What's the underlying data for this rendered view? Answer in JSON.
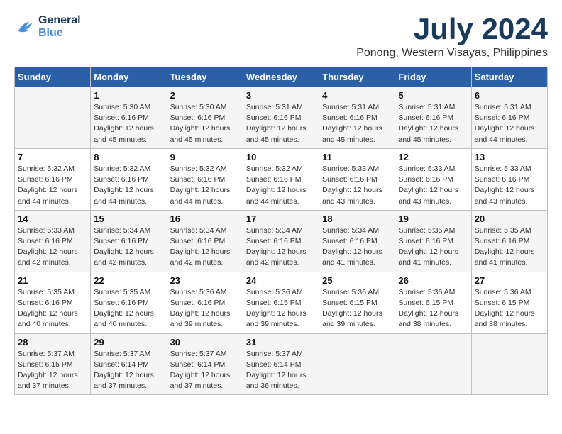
{
  "header": {
    "logo_line1": "General",
    "logo_line2": "Blue",
    "title": "July 2024",
    "subtitle": "Ponong, Western Visayas, Philippines"
  },
  "calendar": {
    "days_of_week": [
      "Sunday",
      "Monday",
      "Tuesday",
      "Wednesday",
      "Thursday",
      "Friday",
      "Saturday"
    ],
    "weeks": [
      [
        {
          "day": "",
          "sunrise": "",
          "sunset": "",
          "daylight": ""
        },
        {
          "day": "1",
          "sunrise": "Sunrise: 5:30 AM",
          "sunset": "Sunset: 6:16 PM",
          "daylight": "Daylight: 12 hours and 45 minutes."
        },
        {
          "day": "2",
          "sunrise": "Sunrise: 5:30 AM",
          "sunset": "Sunset: 6:16 PM",
          "daylight": "Daylight: 12 hours and 45 minutes."
        },
        {
          "day": "3",
          "sunrise": "Sunrise: 5:31 AM",
          "sunset": "Sunset: 6:16 PM",
          "daylight": "Daylight: 12 hours and 45 minutes."
        },
        {
          "day": "4",
          "sunrise": "Sunrise: 5:31 AM",
          "sunset": "Sunset: 6:16 PM",
          "daylight": "Daylight: 12 hours and 45 minutes."
        },
        {
          "day": "5",
          "sunrise": "Sunrise: 5:31 AM",
          "sunset": "Sunset: 6:16 PM",
          "daylight": "Daylight: 12 hours and 45 minutes."
        },
        {
          "day": "6",
          "sunrise": "Sunrise: 5:31 AM",
          "sunset": "Sunset: 6:16 PM",
          "daylight": "Daylight: 12 hours and 44 minutes."
        }
      ],
      [
        {
          "day": "7",
          "sunrise": "Sunrise: 5:32 AM",
          "sunset": "Sunset: 6:16 PM",
          "daylight": "Daylight: 12 hours and 44 minutes."
        },
        {
          "day": "8",
          "sunrise": "Sunrise: 5:32 AM",
          "sunset": "Sunset: 6:16 PM",
          "daylight": "Daylight: 12 hours and 44 minutes."
        },
        {
          "day": "9",
          "sunrise": "Sunrise: 5:32 AM",
          "sunset": "Sunset: 6:16 PM",
          "daylight": "Daylight: 12 hours and 44 minutes."
        },
        {
          "day": "10",
          "sunrise": "Sunrise: 5:32 AM",
          "sunset": "Sunset: 6:16 PM",
          "daylight": "Daylight: 12 hours and 44 minutes."
        },
        {
          "day": "11",
          "sunrise": "Sunrise: 5:33 AM",
          "sunset": "Sunset: 6:16 PM",
          "daylight": "Daylight: 12 hours and 43 minutes."
        },
        {
          "day": "12",
          "sunrise": "Sunrise: 5:33 AM",
          "sunset": "Sunset: 6:16 PM",
          "daylight": "Daylight: 12 hours and 43 minutes."
        },
        {
          "day": "13",
          "sunrise": "Sunrise: 5:33 AM",
          "sunset": "Sunset: 6:16 PM",
          "daylight": "Daylight: 12 hours and 43 minutes."
        }
      ],
      [
        {
          "day": "14",
          "sunrise": "Sunrise: 5:33 AM",
          "sunset": "Sunset: 6:16 PM",
          "daylight": "Daylight: 12 hours and 42 minutes."
        },
        {
          "day": "15",
          "sunrise": "Sunrise: 5:34 AM",
          "sunset": "Sunset: 6:16 PM",
          "daylight": "Daylight: 12 hours and 42 minutes."
        },
        {
          "day": "16",
          "sunrise": "Sunrise: 5:34 AM",
          "sunset": "Sunset: 6:16 PM",
          "daylight": "Daylight: 12 hours and 42 minutes."
        },
        {
          "day": "17",
          "sunrise": "Sunrise: 5:34 AM",
          "sunset": "Sunset: 6:16 PM",
          "daylight": "Daylight: 12 hours and 42 minutes."
        },
        {
          "day": "18",
          "sunrise": "Sunrise: 5:34 AM",
          "sunset": "Sunset: 6:16 PM",
          "daylight": "Daylight: 12 hours and 41 minutes."
        },
        {
          "day": "19",
          "sunrise": "Sunrise: 5:35 AM",
          "sunset": "Sunset: 6:16 PM",
          "daylight": "Daylight: 12 hours and 41 minutes."
        },
        {
          "day": "20",
          "sunrise": "Sunrise: 5:35 AM",
          "sunset": "Sunset: 6:16 PM",
          "daylight": "Daylight: 12 hours and 41 minutes."
        }
      ],
      [
        {
          "day": "21",
          "sunrise": "Sunrise: 5:35 AM",
          "sunset": "Sunset: 6:16 PM",
          "daylight": "Daylight: 12 hours and 40 minutes."
        },
        {
          "day": "22",
          "sunrise": "Sunrise: 5:35 AM",
          "sunset": "Sunset: 6:16 PM",
          "daylight": "Daylight: 12 hours and 40 minutes."
        },
        {
          "day": "23",
          "sunrise": "Sunrise: 5:36 AM",
          "sunset": "Sunset: 6:16 PM",
          "daylight": "Daylight: 12 hours and 39 minutes."
        },
        {
          "day": "24",
          "sunrise": "Sunrise: 5:36 AM",
          "sunset": "Sunset: 6:15 PM",
          "daylight": "Daylight: 12 hours and 39 minutes."
        },
        {
          "day": "25",
          "sunrise": "Sunrise: 5:36 AM",
          "sunset": "Sunset: 6:15 PM",
          "daylight": "Daylight: 12 hours and 39 minutes."
        },
        {
          "day": "26",
          "sunrise": "Sunrise: 5:36 AM",
          "sunset": "Sunset: 6:15 PM",
          "daylight": "Daylight: 12 hours and 38 minutes."
        },
        {
          "day": "27",
          "sunrise": "Sunrise: 5:36 AM",
          "sunset": "Sunset: 6:15 PM",
          "daylight": "Daylight: 12 hours and 38 minutes."
        }
      ],
      [
        {
          "day": "28",
          "sunrise": "Sunrise: 5:37 AM",
          "sunset": "Sunset: 6:15 PM",
          "daylight": "Daylight: 12 hours and 37 minutes."
        },
        {
          "day": "29",
          "sunrise": "Sunrise: 5:37 AM",
          "sunset": "Sunset: 6:14 PM",
          "daylight": "Daylight: 12 hours and 37 minutes."
        },
        {
          "day": "30",
          "sunrise": "Sunrise: 5:37 AM",
          "sunset": "Sunset: 6:14 PM",
          "daylight": "Daylight: 12 hours and 37 minutes."
        },
        {
          "day": "31",
          "sunrise": "Sunrise: 5:37 AM",
          "sunset": "Sunset: 6:14 PM",
          "daylight": "Daylight: 12 hours and 36 minutes."
        },
        {
          "day": "",
          "sunrise": "",
          "sunset": "",
          "daylight": ""
        },
        {
          "day": "",
          "sunrise": "",
          "sunset": "",
          "daylight": ""
        },
        {
          "day": "",
          "sunrise": "",
          "sunset": "",
          "daylight": ""
        }
      ]
    ]
  }
}
